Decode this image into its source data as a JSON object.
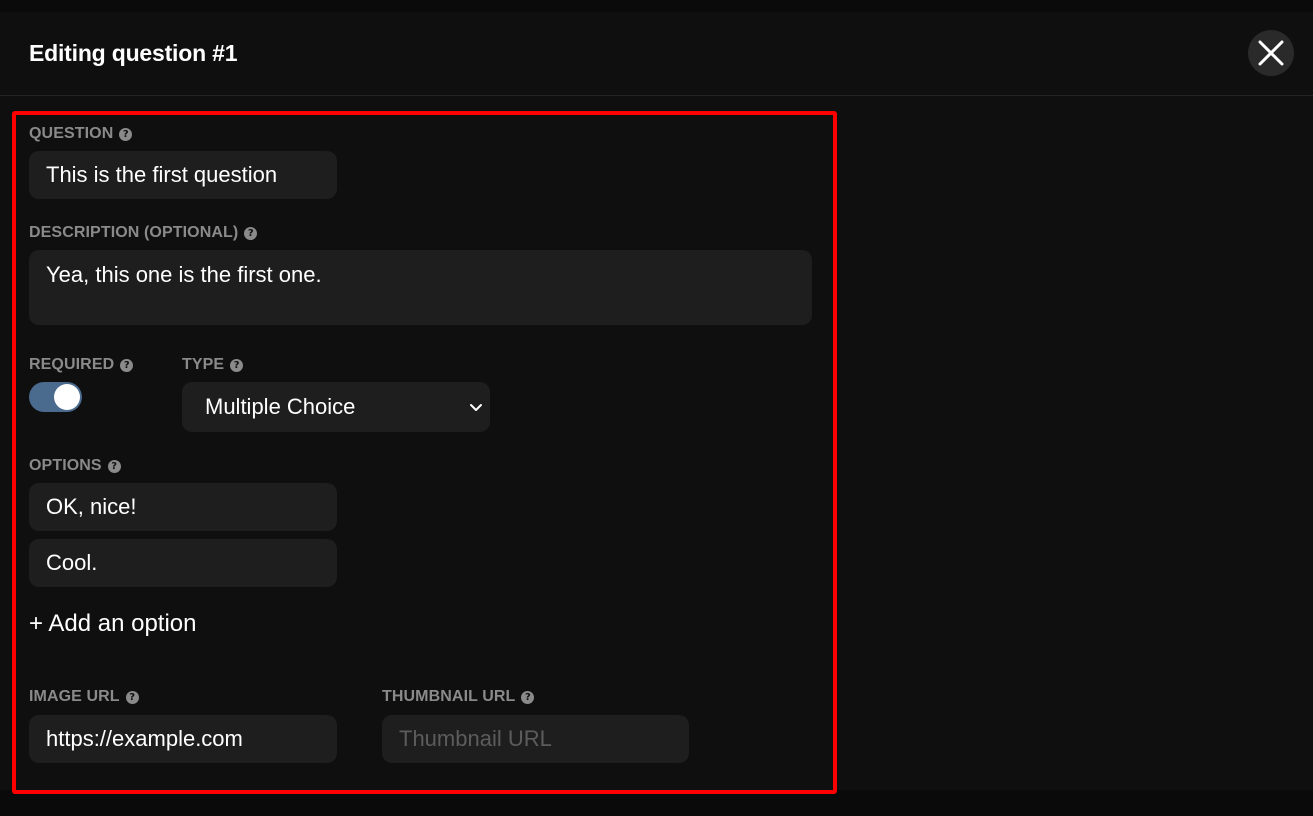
{
  "modal": {
    "title": "Editing question #1",
    "close_icon": "close-icon"
  },
  "form": {
    "question": {
      "label": "QUESTION",
      "value": "This is the first question"
    },
    "description": {
      "label": "DESCRIPTION (OPTIONAL)",
      "value": "Yea, this one is the first one."
    },
    "required": {
      "label": "REQUIRED",
      "on": true
    },
    "type": {
      "label": "TYPE",
      "selected": "Multiple Choice"
    },
    "options": {
      "label": "OPTIONS",
      "items": [
        "OK, nice!",
        "Cool."
      ],
      "add_label": "+ Add an option"
    },
    "image_url": {
      "label": "IMAGE URL",
      "value": "https://example.com"
    },
    "thumbnail_url": {
      "label": "THUMBNAIL URL",
      "placeholder": "Thumbnail URL"
    },
    "help_icon": "?"
  },
  "colors": {
    "background": "#0f0f0f",
    "field": "#1e1e1e",
    "label": "#8a8a8a",
    "toggle_on": "#4a6a8e",
    "highlight": "#ff0000"
  }
}
